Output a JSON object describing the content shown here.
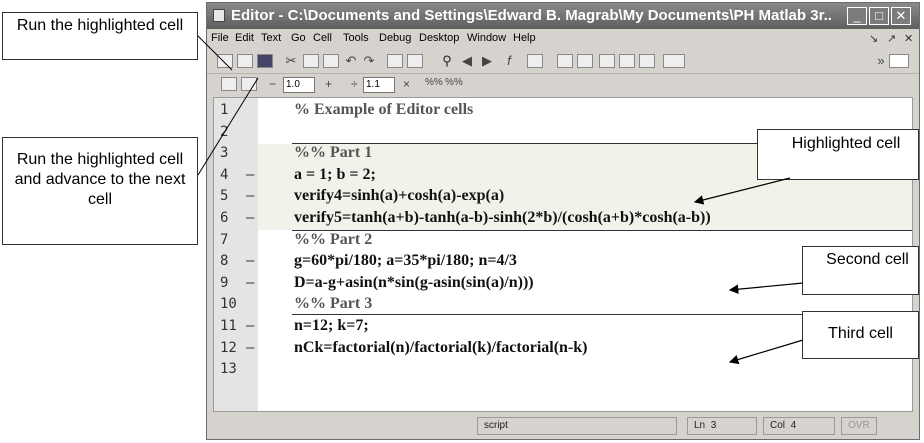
{
  "window": {
    "title": "Editor - C:\\Documents and Settings\\Edward B. Magrab\\My Documents\\PH Matlab 3r...",
    "min_label": "_",
    "max_label": "□",
    "close_label": "✕"
  },
  "menu": [
    "File",
    "Edit",
    "Text",
    "Go",
    "Cell",
    "Tools",
    "Debug",
    "Desktop",
    "Window",
    "Help"
  ],
  "menu_right": [
    "↘",
    "↗",
    "✕"
  ],
  "toolbar2": {
    "minus": "−",
    "value1": "1.0",
    "plus": "+",
    "divide": "÷",
    "value2": "1.1",
    "times": "×"
  },
  "code": {
    "line_numbers": [
      "1",
      "2",
      "3",
      "4",
      "5",
      "6",
      "7",
      "8",
      "9",
      "10",
      "11",
      "12",
      "13"
    ],
    "dashes": [
      "",
      "",
      "",
      "–",
      "–",
      "–",
      "",
      "–",
      "–",
      "",
      "–",
      "–",
      ""
    ],
    "lines": [
      "% Example of Editor cells",
      "",
      "%% Part 1",
      "a = 1;  b = 2;",
      "verify4=sinh(a)+cosh(a)-exp(a)",
      "verify5=tanh(a+b)-tanh(a-b)-sinh(2*b)/(cosh(a+b)*cosh(a-b))",
      "%% Part 2",
      "g=60*pi/180;  a=35*pi/180; n=4/3",
      "D=a-g+asin(n*sin(g-asin(sin(a)/n)))",
      "%% Part 3",
      "n=12;  k=7;",
      "nCk=factorial(n)/factorial(k)/factorial(n-k)",
      ""
    ]
  },
  "status": {
    "mode": "script",
    "ln_label": "Ln",
    "ln_value": "3",
    "col_label": "Col",
    "col_value": "4",
    "ovr": "OVR"
  },
  "callouts": {
    "run_cell": "Run the highlighted cell",
    "run_advance": "Run the highlighted cell and advance to the next cell",
    "highlighted": "Highlighted cell",
    "second": "Second cell",
    "third": "Third cell"
  },
  "icons": [
    "editor-app-icon",
    "new-file-icon",
    "open-file-icon",
    "save-icon",
    "cut-icon",
    "copy-icon",
    "paste-icon",
    "undo-icon",
    "redo-icon",
    "print-icon",
    "find-icon",
    "back-icon",
    "forward-icon",
    "function-icon",
    "breakpoint-icon",
    "run-cell-icon",
    "run-advance-icon"
  ]
}
